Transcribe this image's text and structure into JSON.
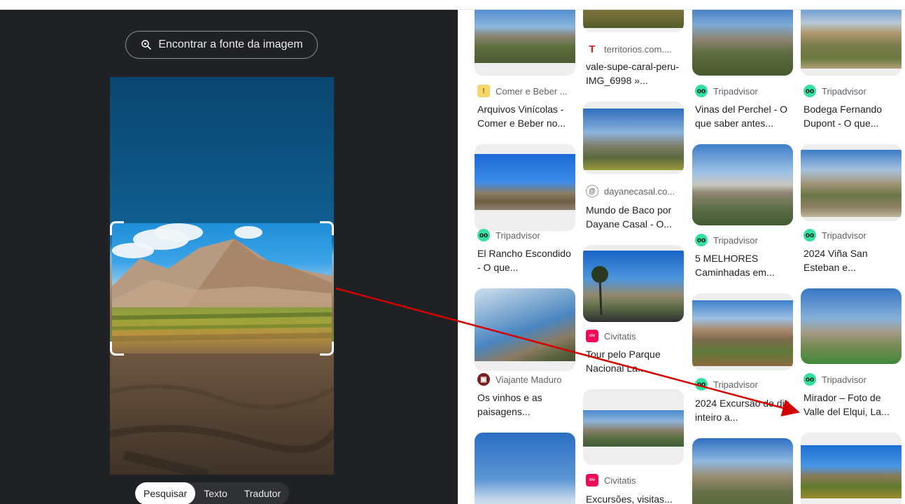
{
  "lens": {
    "find_source_label": "Encontrar a fonte da imagem",
    "tabs": [
      {
        "label": "Pesquisar",
        "active": true
      },
      {
        "label": "Texto",
        "active": false
      },
      {
        "label": "Tradutor",
        "active": false
      }
    ]
  },
  "results": {
    "col1": [
      {
        "source": "Comer e Beber ...",
        "title": "Arquivos Vinícolas - Comer e Beber no...",
        "icon": "comer-beber-icon"
      },
      {
        "source": "Tripadvisor",
        "title": "El Rancho Escondido - O que...",
        "icon": "tripadvisor-icon"
      },
      {
        "source": "Viajante Maduro",
        "title": "Os vinhos e as paisagens...",
        "icon": "viajante-icon"
      }
    ],
    "col2": [
      {
        "source": "territorios.com....",
        "title": "vale-supe-caral-peru-IMG_6998 »...",
        "icon": "territorios-icon"
      },
      {
        "source": "dayanecasal.co...",
        "title": "Mundo de Baco por Dayane Casal - O...",
        "icon": "dayanecasal-icon"
      },
      {
        "source": "Civitatis",
        "title": "Tour pelo Parque Nacional La...",
        "icon": "civitatis-icon"
      },
      {
        "source": "Civitatis",
        "title": "Excursões, visitas...",
        "icon": "civitatis-icon"
      }
    ],
    "col3": [
      {
        "source": "Tripadvisor",
        "title": "Vinas del Perchel - O que saber antes...",
        "icon": "tripadvisor-icon"
      },
      {
        "source": "Tripadvisor",
        "title": "5 MELHORES Caminhadas em...",
        "icon": "tripadvisor-icon"
      },
      {
        "source": "Tripadvisor",
        "title": "2024 Excursão de dia inteiro a...",
        "icon": "tripadvisor-icon"
      }
    ],
    "col4": [
      {
        "source": "Tripadvisor",
        "title": "Bodega Fernando Dupont - O que...",
        "icon": "tripadvisor-icon"
      },
      {
        "source": "Tripadvisor",
        "title": "2024 Viña San Esteban e...",
        "icon": "tripadvisor-icon"
      },
      {
        "source": "Tripadvisor",
        "title": "Mirador – Foto de Valle del Elqui, La...",
        "icon": "tripadvisor-icon"
      }
    ]
  },
  "colors": {
    "left_panel_bg": "#202124",
    "arrow": "#d40000",
    "tripadvisor": "#34e0a1",
    "civitatis": "#f70759"
  }
}
